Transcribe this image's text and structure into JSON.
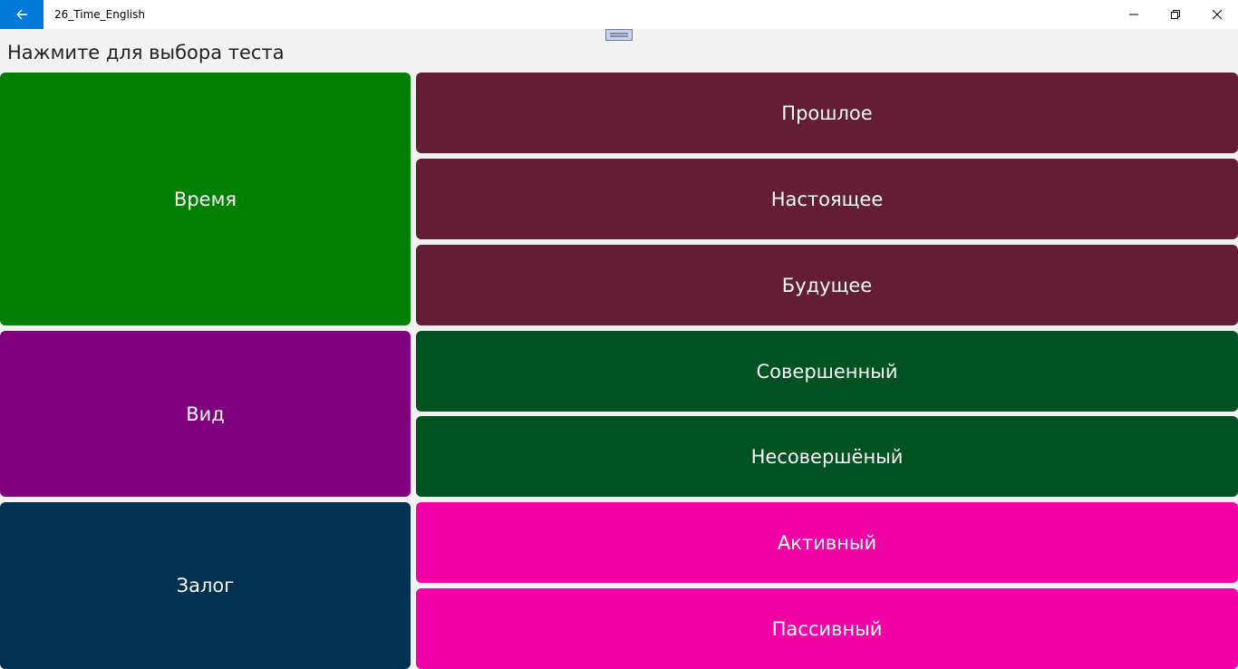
{
  "window": {
    "title": "26_Time_English",
    "back_icon": "arrow-left-icon",
    "accent": "#0078d7"
  },
  "page": {
    "prompt": "Нажмите для выбора теста"
  },
  "categories": [
    {
      "label": "Время",
      "color": "#008000"
    },
    {
      "label": "Вид",
      "color": "#800080"
    },
    {
      "label": "Залог",
      "color": "#003153"
    }
  ],
  "options": [
    {
      "label": "Прошлое",
      "color": "#651d35"
    },
    {
      "label": "Настоящее",
      "color": "#651d35"
    },
    {
      "label": "Будущее",
      "color": "#651d35"
    },
    {
      "label": "Совершенный",
      "color": "#005220"
    },
    {
      "label": "Несовершёный",
      "color": "#005220"
    },
    {
      "label": "Активный",
      "color": "#f203a8"
    },
    {
      "label": "Пассивный",
      "color": "#f203a8"
    }
  ]
}
